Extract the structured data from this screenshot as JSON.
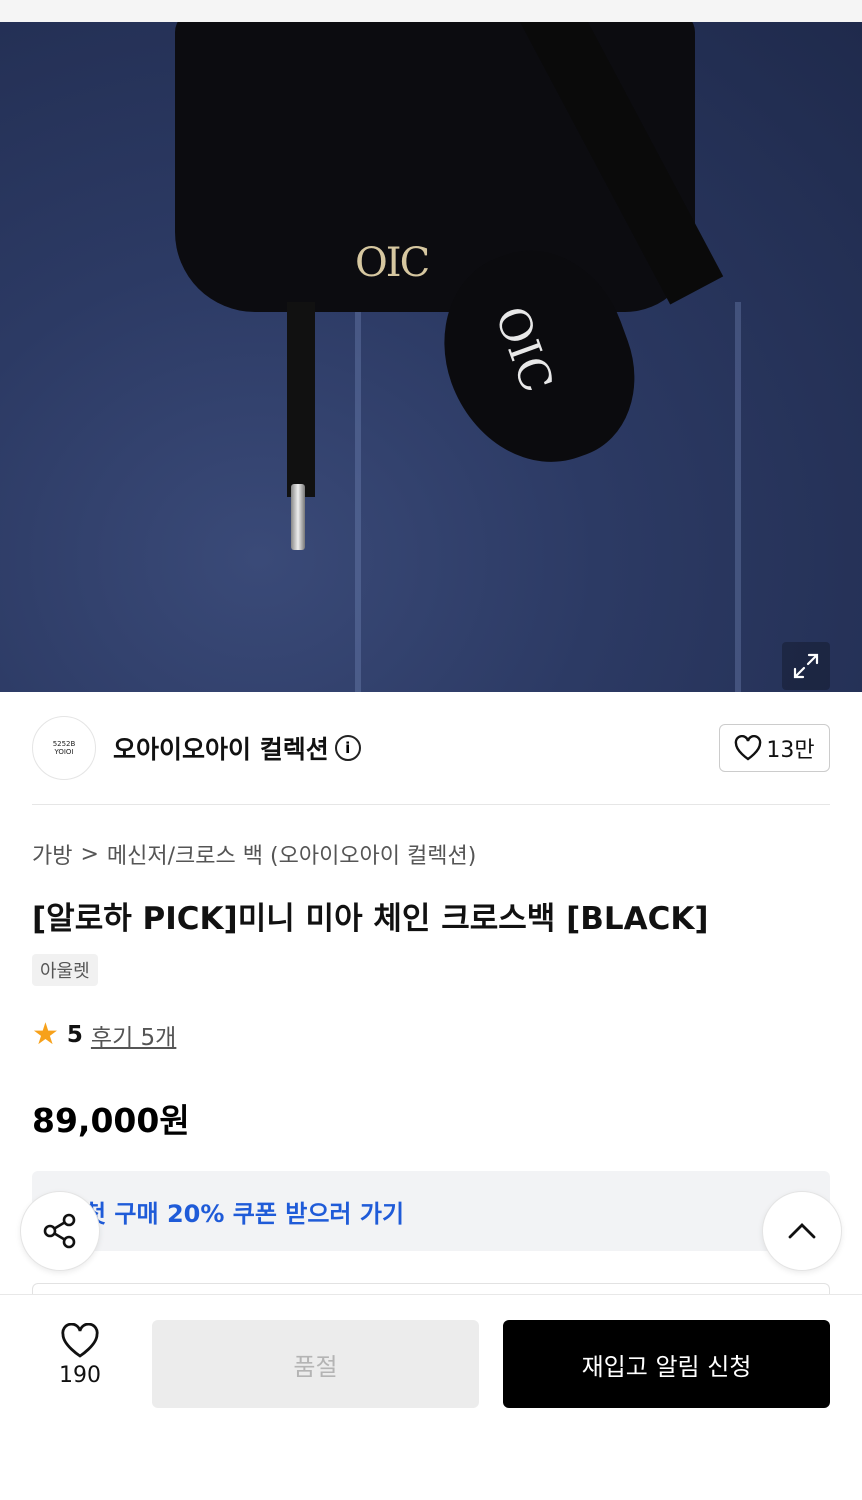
{
  "brand": {
    "avatar_line1": "5252B",
    "avatar_line2": "YOIOI",
    "name": "오아이오아이 컬렉션",
    "info_icon": "i",
    "favorite_count": "13만"
  },
  "breadcrumb": {
    "category": "가방",
    "separator": ">",
    "subcategory": "메신저/크로스 백 (오아이오아이 컬렉션)"
  },
  "product": {
    "title": "[알로하 PICK]미니 미아 체인 크로스백 [BLACK]",
    "tag": "아울렛",
    "rating": "5",
    "review_link": "후기 5개",
    "price": "89,000원"
  },
  "image": {
    "logo_text": "OIC",
    "heart_logo_text": "OIC"
  },
  "coupon": {
    "label": "첫 구매 20% 쿠폰 받으러 가기",
    "chevron": "›"
  },
  "bottom_bar": {
    "like_count": "190",
    "soldout_label": "품절",
    "restock_label": "재입고 알림 신청"
  },
  "icons": {
    "expand": "expand-icon",
    "heart": "heart-icon",
    "star": "star-icon",
    "share": "share-icon",
    "scroll_top": "chevron-up-icon"
  },
  "colors": {
    "coupon_text": "#1f5bd8",
    "star": "#f7a11a",
    "restock_button": "#000000",
    "soldout_button": "#ececec"
  }
}
